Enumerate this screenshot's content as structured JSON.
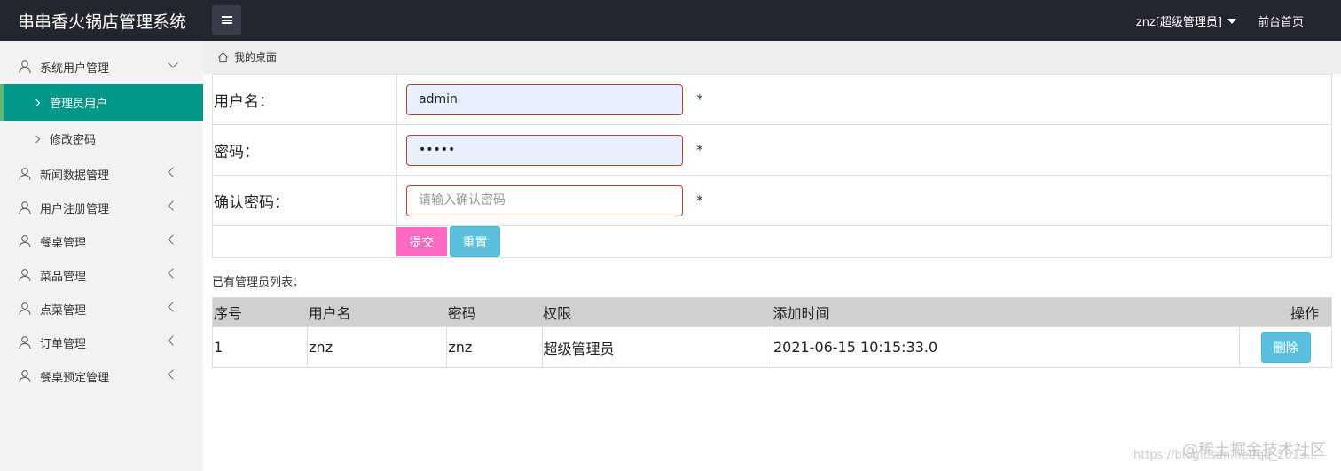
{
  "header": {
    "app_title": "串串香火锅店管理系统",
    "user_label": "znz[超级管理员]",
    "front_link": "前台首页"
  },
  "sidebar": {
    "groups": [
      {
        "label": "系统用户管理",
        "expanded": true,
        "icon": "user-icon"
      },
      {
        "label": "新闻数据管理",
        "expanded": false,
        "icon": "user-icon"
      },
      {
        "label": "用户注册管理",
        "expanded": false,
        "icon": "user-icon"
      },
      {
        "label": "餐桌管理",
        "expanded": false,
        "icon": "user-icon"
      },
      {
        "label": "菜品管理",
        "expanded": false,
        "icon": "user-icon"
      },
      {
        "label": "点菜管理",
        "expanded": false,
        "icon": "user-icon"
      },
      {
        "label": "订单管理",
        "expanded": false,
        "icon": "user-icon"
      },
      {
        "label": "餐桌预定管理",
        "expanded": false,
        "icon": "user-icon"
      }
    ],
    "sub_items": [
      {
        "label": "管理员用户",
        "active": true
      },
      {
        "label": "修改密码",
        "active": false
      }
    ],
    "active_color": "#009688"
  },
  "breadcrumb": {
    "icon": "home-icon",
    "label": "我的桌面"
  },
  "form": {
    "username_label": "用户名：",
    "username_value": "admin",
    "password_label": "密码：",
    "password_value": "admin",
    "confirm_label": "确认密码：",
    "confirm_placeholder": "请输入确认密码",
    "required_mark": "*",
    "submit_label": "提交",
    "reset_label": "重置"
  },
  "admin_list": {
    "caption": "已有管理员列表：",
    "columns": [
      "序号",
      "用户名",
      "密码",
      "权限",
      "添加时间",
      "操作"
    ],
    "rows": [
      {
        "index": "1",
        "username": "znz",
        "password": "znz",
        "role": "超级管理员",
        "added": "2021-06-15 10:15:33.0",
        "action": "删除"
      }
    ]
  },
  "watermark": {
    "brand": "@稀土掘金技术社区",
    "url": "https://blog.csdn.net/qq_2613..."
  },
  "colors": {
    "header_bg": "#23262e",
    "submit_btn": "#ff69c4",
    "info_btn": "#5bc0de"
  }
}
